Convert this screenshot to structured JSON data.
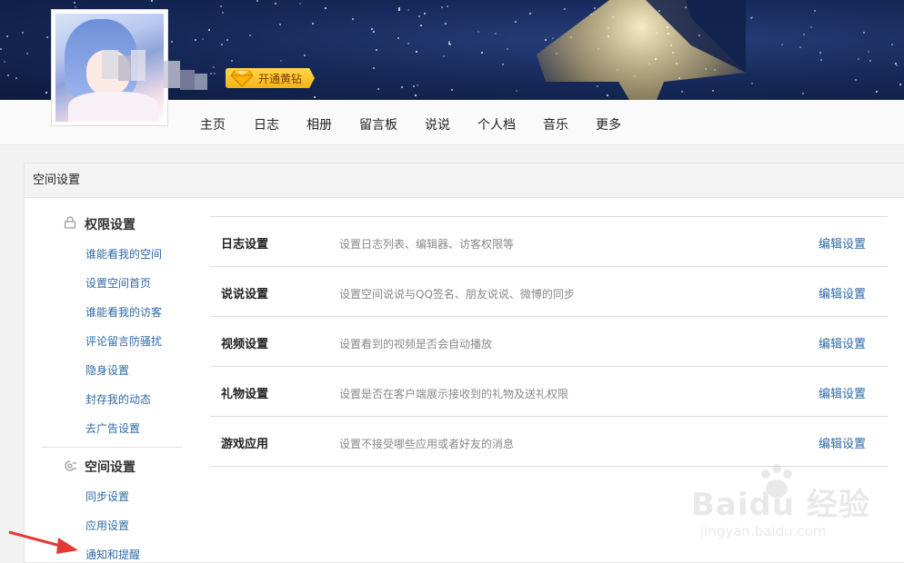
{
  "header": {
    "vip_button": "开通黄钻"
  },
  "nav": {
    "items": [
      "主页",
      "日志",
      "相册",
      "留言板",
      "说说",
      "个人档",
      "音乐",
      "更多"
    ]
  },
  "panel": {
    "title": "空间设置"
  },
  "sidebar": {
    "groups": [
      {
        "title": "权限设置",
        "icon": "lock-icon",
        "links": [
          "谁能看我的空间",
          "设置空间首页",
          "谁能看我的访客",
          "评论留言防骚扰",
          "隐身设置",
          "封存我的动态",
          "去广告设置"
        ]
      },
      {
        "title": "空间设置",
        "icon": "gear-icon",
        "links": [
          "同步设置",
          "应用设置",
          "通知和提醒"
        ]
      }
    ]
  },
  "settings": {
    "edit_label": "编辑设置",
    "rows": [
      {
        "title": "日志设置",
        "desc": "设置日志列表、编辑器、访客权限等"
      },
      {
        "title": "说说设置",
        "desc": "设置空间说说与QQ签名、朋友说说、微博的同步"
      },
      {
        "title": "视频设置",
        "desc": "设置看到的视频是否会自动播放"
      },
      {
        "title": "礼物设置",
        "desc": "设置是否在客户端展示接收到的礼物及送礼权限"
      },
      {
        "title": "游戏应用",
        "desc": "设置不接受哪些应用或者好友的消息"
      }
    ]
  },
  "watermark": {
    "main": "Baidu 经验",
    "sub": "jingyan.baidu.com"
  },
  "colors": {
    "link": "#2e6aa6",
    "vip_gold": "#f5b315",
    "banner_dark": "#0d1b3e"
  }
}
